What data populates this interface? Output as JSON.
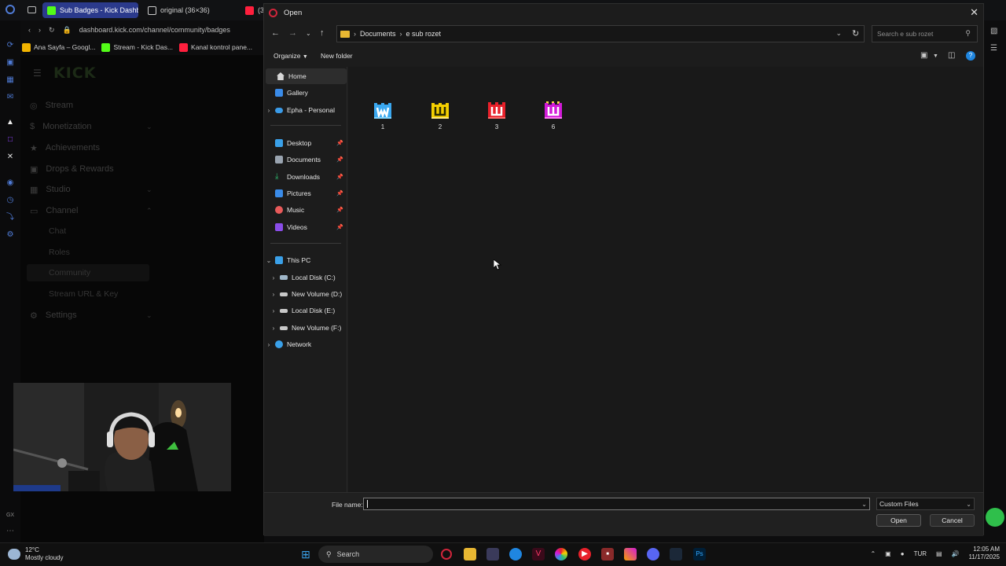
{
  "browser": {
    "tabs": [
      {
        "label": "Sub Badges - Kick Dashb",
        "active": true,
        "color": "#53fc18"
      },
      {
        "label": "original (36×36)",
        "active": false,
        "color": "#dddddd"
      },
      {
        "label": "(3",
        "active": false,
        "color": "#ff1f3d"
      }
    ],
    "url": "dashboard.kick.com/channel/community/badges",
    "bookmarks": [
      {
        "label": "Ana Sayfa – Googl...",
        "color": "#f2b400"
      },
      {
        "label": "Stream - Kick Das...",
        "color": "#53fc18"
      },
      {
        "label": "Kanal kontrol pane...",
        "color": "#ff1f3d"
      }
    ]
  },
  "kick": {
    "logo": "KICK",
    "menu": [
      {
        "label": "Stream",
        "icon": "broadcast-icon",
        "chevron": false
      },
      {
        "label": "Monetization",
        "icon": "dollar-icon",
        "chevron": true
      },
      {
        "label": "Achievements",
        "icon": "trophy-icon",
        "chevron": false
      },
      {
        "label": "Drops & Rewards",
        "icon": "gift-icon",
        "chevron": false
      },
      {
        "label": "Studio",
        "icon": "grid-icon",
        "chevron": true
      },
      {
        "label": "Channel",
        "icon": "tv-icon",
        "chevron": true
      }
    ],
    "channel_sub": [
      "Chat",
      "Roles",
      "Community",
      "Stream URL & Key"
    ],
    "settings": "Settings"
  },
  "dialog": {
    "title": "Open",
    "path": [
      "Documents",
      "e sub rozet"
    ],
    "search_placeholder": "Search e sub rozet",
    "organize": "Organize",
    "new_folder": "New folder",
    "nav": {
      "home": "Home",
      "gallery": "Gallery",
      "onedrive": "Epha - Personal",
      "quick": [
        {
          "label": "Desktop",
          "color": "#3aa0e8"
        },
        {
          "label": "Documents",
          "color": "#9aa4b0"
        },
        {
          "label": "Downloads",
          "color": "#2fbf71"
        },
        {
          "label": "Pictures",
          "color": "#3a8be8"
        },
        {
          "label": "Music",
          "color": "#e85a5a"
        },
        {
          "label": "Videos",
          "color": "#8a4de8"
        }
      ],
      "this_pc": "This PC",
      "drives": [
        "Local Disk (C:)",
        "New Volume (D:)",
        "Local Disk (E:)",
        "New Volume (F:)"
      ],
      "network": "Network"
    },
    "files": [
      {
        "name": "1",
        "color": "#3aa8f0",
        "accent": "#7fd4ff"
      },
      {
        "name": "2",
        "color": "#f5d000",
        "accent": "#ffe97a"
      },
      {
        "name": "3",
        "color": "#e8202a",
        "accent": "#ff6a6a"
      },
      {
        "name": "6",
        "color": "#d21ad8",
        "accent": "#ff7af5"
      }
    ],
    "file_name_label": "File name:",
    "file_name_value": "",
    "file_type": "Custom Files",
    "open_button": "Open",
    "cancel_button": "Cancel"
  },
  "taskbar": {
    "weather_temp": "12°C",
    "weather_desc": "Mostly cloudy",
    "search": "Search",
    "lang": "TUR",
    "time": "12:05 AM",
    "date": "11/17/2025"
  }
}
